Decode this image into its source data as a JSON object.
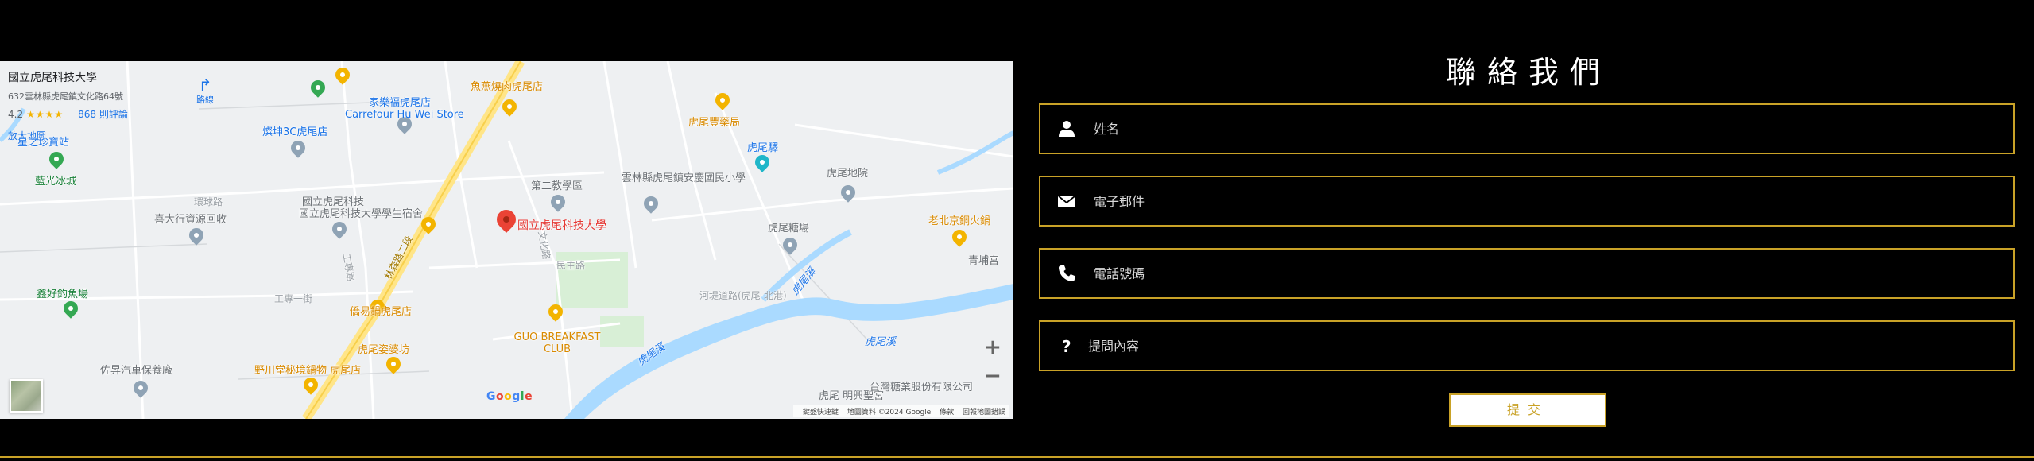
{
  "map": {
    "place_card": {
      "name": "國立虎尾科技大學",
      "address": "632雲林縣虎尾鎮文化路64號",
      "rating": "4.2",
      "stars": "★★★★",
      "reviews": "868 則評論",
      "larger_map": "放大地圖"
    },
    "directions_label": "路線",
    "main_pin_label": "國立虎尾科技大學",
    "labels": {
      "carrefour_zh": "家樂福虎尾店",
      "carrefour_en": "Carrefour Hu Wei Store",
      "yuanlu": "魚燕燒肉虎尾店",
      "yongkang": "虎尾豐藥局",
      "huwei_pharmacy": "虎尾驛",
      "yuxing": "燦坤3C虎尾店",
      "shine": "星之珍寶站",
      "lanbo": "藍光冰城",
      "huwei_tech_student": "國立虎尾科技大學學生宿舍",
      "second_teaching": "第二教學區",
      "yunlin_school": "雲林縣虎尾鎮安慶國民小學",
      "huwei_court": "虎尾地院",
      "huwei_station": "虎尾糖場",
      "old_beijing": "老北京銅火鍋",
      "qingpu": "青埔宮",
      "gree": "喜大行資源回收",
      "fish_farm": "鑫好釣魚場",
      "lubing": "僑易鍋虎尾店",
      "guo": "GUO BREAKFAST CLUB",
      "huwei_cake": "虎尾姿婆坊",
      "yechuan": "野川堂秘境鍋物 虎尾店",
      "zuopin": "佐昇汽車保養廠",
      "huwei_creek_1": "虎尾溪",
      "huwei_creek_2": "虎尾溪",
      "huwei_creek_3": "虎尾溪",
      "linsen_road": "林森路二段",
      "gongye_road": "工專路",
      "wenhua_road": "文化路",
      "minzhu_road": "民主路",
      "huanqiu": "環球路",
      "gongye_1": "工專一街",
      "creek_road": "河堤道路(虎尾-北港)",
      "huwei_ent": "虎尾 明興聖宮",
      "taiwan_sugar": "台灣糖業股份有限公司"
    },
    "zoom_in": "+",
    "zoom_out": "−",
    "google": [
      "G",
      "o",
      "o",
      "g",
      "l",
      "e"
    ],
    "attribution": {
      "shortcuts": "鍵盤快速鍵",
      "map_data": "地圖資料 ©2024 Google",
      "terms": "條款",
      "report": "回報地圖錯誤"
    }
  },
  "contact": {
    "title": "聯絡我們",
    "fields": {
      "name": "姓名",
      "email": "電子郵件",
      "phone": "電話號碼",
      "question": "提問內容"
    },
    "submit_label": "提交"
  },
  "colors": {
    "accent": "#c9a227",
    "background": "#000000",
    "text": "#ffffff"
  },
  "icons": {
    "name": "user-icon",
    "email": "envelope-icon",
    "phone": "phone-icon",
    "question": "question-icon"
  }
}
